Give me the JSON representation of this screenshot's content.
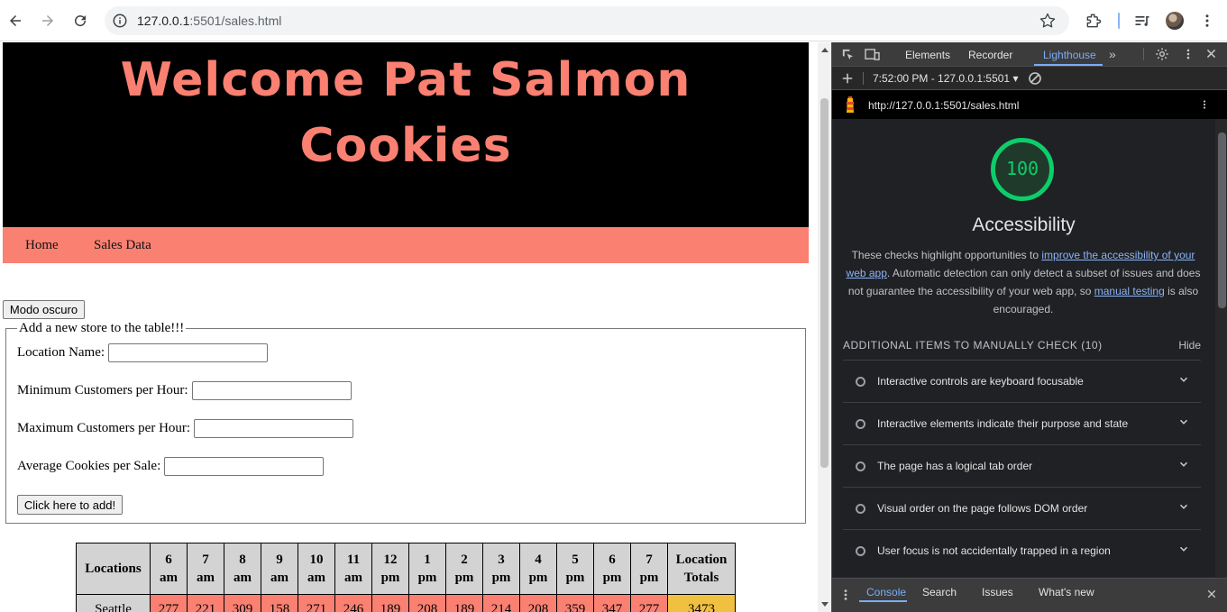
{
  "browser": {
    "url_host": "127.0.0.1",
    "url_rest": ":5501/sales.html"
  },
  "page": {
    "title_line1": "Welcome Pat Salmon",
    "title_line2": "Cookies",
    "nav": [
      "Home",
      "Sales Data"
    ],
    "dark_mode_button": "Modo oscuro",
    "form": {
      "legend": "Add a new store to the table!!!",
      "location_label": "Location Name:",
      "min_label": "Minimum Customers per Hour:",
      "max_label": "Maximum Customers per Hour:",
      "avg_label": "Average Cookies per Sale:",
      "location_value": "",
      "min_value": "",
      "max_value": "",
      "avg_value": "",
      "submit_label": "Click here to add!"
    },
    "table": {
      "corner": "Locations",
      "hours": [
        [
          "6",
          "am"
        ],
        [
          "7",
          "am"
        ],
        [
          "8",
          "am"
        ],
        [
          "9",
          "am"
        ],
        [
          "10",
          "am"
        ],
        [
          "11",
          "am"
        ],
        [
          "12",
          "pm"
        ],
        [
          "1",
          "pm"
        ],
        [
          "2",
          "pm"
        ],
        [
          "3",
          "pm"
        ],
        [
          "4",
          "pm"
        ],
        [
          "5",
          "pm"
        ],
        [
          "6",
          "pm"
        ],
        [
          "7",
          "pm"
        ]
      ],
      "total_header": [
        "Location",
        "Totals"
      ],
      "rows": [
        {
          "name": "Seattle",
          "values": [
            "277",
            "221",
            "309",
            "158",
            "271",
            "246",
            "189",
            "208",
            "189",
            "214",
            "208",
            "359",
            "347",
            "277"
          ],
          "total": "3473"
        }
      ],
      "colors": {
        "header": "#d3d3d3",
        "cell": "#fa8072",
        "total": "#f0c040"
      }
    },
    "colors": {
      "accent": "#fa8072",
      "header_bg": "#000000"
    }
  },
  "devtools": {
    "tabs": [
      "Elements",
      "Recorder",
      "Lighthouse"
    ],
    "active_tab": "Lighthouse",
    "report_time": "7:52:00 PM - 127.0.0.1:5501",
    "report_url": "http://127.0.0.1:5501/sales.html",
    "score": "100",
    "category": "Accessibility",
    "desc_1": "These checks highlight opportunities to ",
    "desc_link1": "improve the accessibility of your web app",
    "desc_2": ". Automatic detection can only detect a subset of issues and does not guarantee the accessibility of your web app, so ",
    "desc_link2": "manual testing",
    "desc_3": " is also encouraged.",
    "manual_header": "ADDITIONAL ITEMS TO MANUALLY CHECK (10)",
    "hide_label": "Hide",
    "audits": [
      "Interactive controls are keyboard focusable",
      "Interactive elements indicate their purpose and state",
      "The page has a logical tab order",
      "Visual order on the page follows DOM order",
      "User focus is not accidentally trapped in a region"
    ],
    "drawer_tabs": [
      "Console",
      "Search",
      "Issues",
      "What's new"
    ],
    "score_color": "#0cce6b"
  }
}
